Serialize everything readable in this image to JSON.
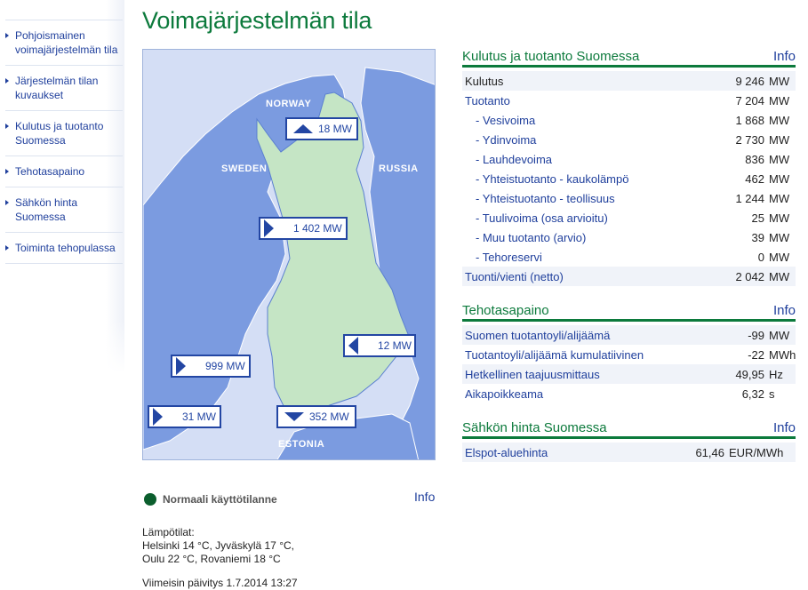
{
  "page_title": "Voimajärjestelmän tila",
  "sidebar": {
    "items": [
      {
        "label": "Pohjoismainen voimajärjestelmän tila"
      },
      {
        "label": "Järjestelmän tilan kuvaukset"
      },
      {
        "label": "Kulutus ja tuotanto Suomessa"
      },
      {
        "label": "Tehotasapaino"
      },
      {
        "label": "Sähkön hinta Suomessa"
      },
      {
        "label": "Toiminta tehopulassa"
      }
    ]
  },
  "map": {
    "countries": {
      "norway": "NORWAY",
      "sweden": "SWEDEN",
      "russia": "RUSSIA",
      "estonia": "ESTONIA"
    },
    "flows": [
      {
        "id": "norway",
        "value": "18 MW",
        "direction": "up"
      },
      {
        "id": "sweden-north",
        "value": "1 402 MW",
        "direction": "right"
      },
      {
        "id": "russia",
        "value": "12 MW",
        "direction": "left"
      },
      {
        "id": "sweden-south",
        "value": "999 MW",
        "direction": "right"
      },
      {
        "id": "aland",
        "value": "31 MW",
        "direction": "right"
      },
      {
        "id": "estonia",
        "value": "352 MW",
        "direction": "down"
      }
    ]
  },
  "status": {
    "label": "Normaali käyttötilanne",
    "color": "#0b5e2d",
    "info_label": "Info"
  },
  "temperatures": {
    "heading": "Lämpötilat:",
    "line1": "Helsinki 14 °C, Jyväskylä 17 °C,",
    "line2": "Oulu 22 °C, Rovaniemi 18 °C"
  },
  "last_update": "Viimeisin päivitys 1.7.2014 13:27",
  "panels": {
    "consumption": {
      "title": "Kulutus ja tuotanto Suomessa",
      "info_label": "Info",
      "rows": [
        {
          "label": "Kulutus",
          "value": "9 246",
          "unit": "MW"
        },
        {
          "label": "Tuotanto",
          "value": "7 204",
          "unit": "MW"
        },
        {
          "label": "- Vesivoima",
          "value": "1 868",
          "unit": "MW"
        },
        {
          "label": "- Ydinvoima",
          "value": "2 730",
          "unit": "MW"
        },
        {
          "label": "- Lauhdevoima",
          "value": "836",
          "unit": "MW"
        },
        {
          "label": "- Yhteistuotanto - kaukolämpö",
          "value": "462",
          "unit": "MW"
        },
        {
          "label": "- Yhteistuotanto - teollisuus",
          "value": "1 244",
          "unit": "MW"
        },
        {
          "label": "- Tuulivoima (osa arvioitu)",
          "value": "25",
          "unit": "MW"
        },
        {
          "label": "- Muu tuotanto (arvio)",
          "value": "39",
          "unit": "MW"
        },
        {
          "label": "- Tehoreservi",
          "value": "0",
          "unit": "MW"
        },
        {
          "label": "Tuonti/vienti (netto)",
          "value": "2 042",
          "unit": "MW"
        }
      ]
    },
    "balance": {
      "title": "Tehotasapaino",
      "info_label": "Info",
      "rows": [
        {
          "label": "Suomen tuotantoyli/alijäämä",
          "value": "-99",
          "unit": "MW"
        },
        {
          "label": "Tuotantoyli/alijäämä kumulatiivinen",
          "value": "-22",
          "unit": "MWh"
        },
        {
          "label": "Hetkellinen taajuusmittaus",
          "value": "49,95",
          "unit": "Hz"
        },
        {
          "label": "Aikapoikkeama",
          "value": "6,32",
          "unit": "s"
        }
      ]
    },
    "price": {
      "title": "Sähkön hinta Suomessa",
      "info_label": "Info",
      "rows": [
        {
          "label": "Elspot-aluehinta",
          "value": "61,46",
          "unit": "EUR/MWh"
        }
      ]
    }
  },
  "colors": {
    "brand_green": "#0c7a3c",
    "link_blue": "#1f3f9c",
    "flow_blue": "#2346a3",
    "land_finland": "#c5e5c5",
    "land_other": "#7b9be0",
    "sea": "#d4def5"
  }
}
